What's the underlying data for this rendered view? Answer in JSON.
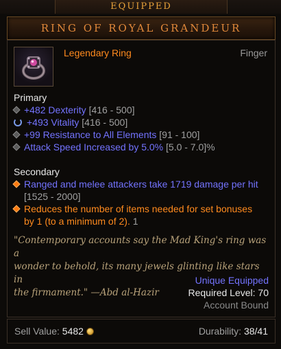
{
  "header": {
    "equipped_label": "EQUIPPED"
  },
  "item": {
    "name": "RING OF ROYAL GRANDEUR",
    "type": "Legendary Ring",
    "slot": "Finger",
    "icon": "ring-icon"
  },
  "primary": {
    "heading": "Primary",
    "stats": [
      {
        "bullet": "gray-diamond",
        "value": "+482 Dexterity",
        "range": "[416 - 500]"
      },
      {
        "bullet": "reroll-icon",
        "value": "+493 Vitality",
        "range": "[416 - 500]"
      },
      {
        "bullet": "gray-diamond",
        "value": "+99 Resistance to All Elements",
        "range": "[91 - 100]"
      },
      {
        "bullet": "gray-diamond",
        "value": "Attack Speed Increased by 5.0%",
        "range": "[5.0 - 7.0]%"
      }
    ]
  },
  "secondary": {
    "heading": "Secondary",
    "stats": [
      {
        "bullet": "orange-diamond",
        "value": "Ranged and melee attackers take 1719 damage per hit",
        "range": "[1525 - 2000]"
      },
      {
        "bullet": "orange-diamond",
        "value_line1": "Reduces the number of items needed for set bonuses",
        "value_line2": "by 1 (to a minimum of 2).",
        "suffix": "1"
      }
    ]
  },
  "flavor": {
    "line1": "\"Contemporary accounts say the Mad King's ring was a",
    "line2": "wonder to behold, its many jewels glinting like stars in",
    "line3": "the firmament.\" —Abd al-Hazir"
  },
  "meta": {
    "unique_equipped": "Unique Equipped",
    "required_level": "Required Level: 70",
    "bound": "Account Bound"
  },
  "footer": {
    "sell_label": "Sell Value:",
    "sell_value": "5482",
    "durability_label": "Durability:",
    "durability_value": "38/41"
  },
  "colors": {
    "legendary_orange": "#ff8a1e",
    "magic_blue": "#7373ff",
    "gray_text": "#a0a0a0",
    "flavor_tan": "#b8a27a"
  }
}
